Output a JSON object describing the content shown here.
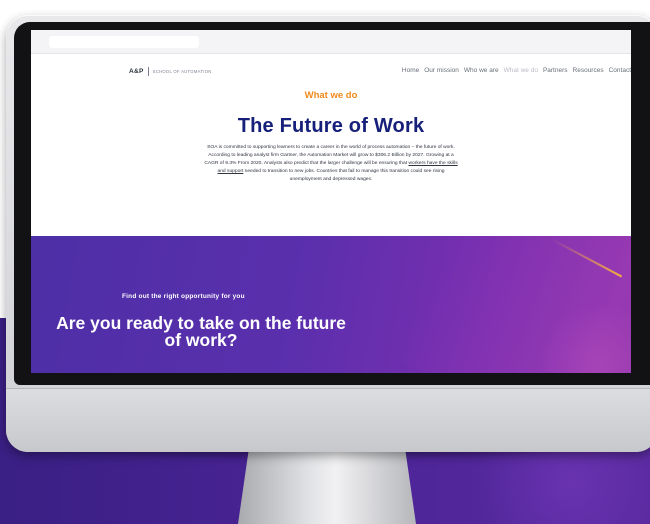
{
  "site": {
    "logo": {
      "mark": "A&P",
      "text": "SCHOOL OF AUTOMATION"
    },
    "nav": [
      {
        "label": "Home"
      },
      {
        "label": "Our mission"
      },
      {
        "label": "Who we are"
      },
      {
        "label": "What we do"
      },
      {
        "label": "Partners"
      },
      {
        "label": "Resources"
      },
      {
        "label": "Contact"
      }
    ]
  },
  "hero": {
    "eyebrow": "What we do",
    "title": "The Future of Work",
    "body_before": "SOA is committed to supporting learners to create a career in the world of process automation – the future of work. According to leading analyst firm Gartner, the Automation Market will grow to $306.2 Billion by 2027. Growing at a CAGR of 9.3% From 2020. Analysts also predict that the larger challenge will be ensuring that ",
    "body_link": "workers have the skills and support",
    "body_after": " needed to transition to new jobs. Countries that fail to manage this transition could see rising unemployment and depressed wages."
  },
  "cta": {
    "subtitle": "Find out the right opportunity for you",
    "title": "Are you ready to take on the future of work?"
  },
  "colors": {
    "accent_orange": "#f08a1c",
    "heading_navy": "#16207a",
    "cta_purple": "#5b2fad",
    "background_purple": "#3a1f84"
  }
}
